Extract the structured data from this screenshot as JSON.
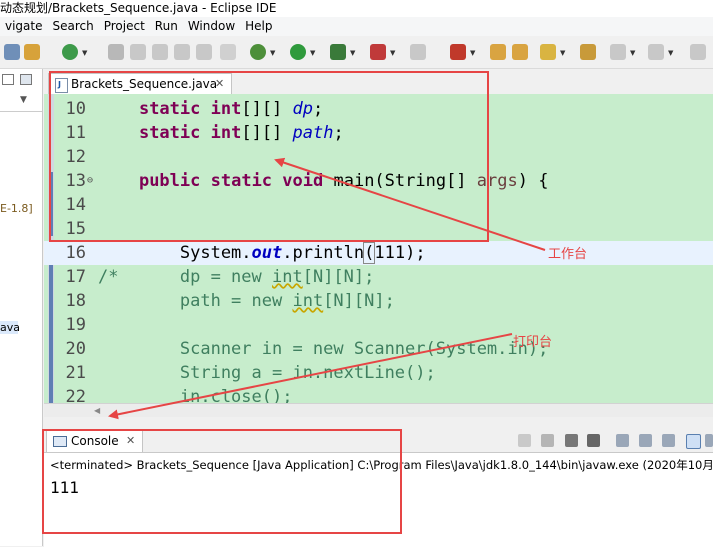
{
  "window": {
    "title": "动态规划/Brackets_Sequence.java - Eclipse IDE"
  },
  "menu": {
    "items": [
      "vigate",
      "Search",
      "Project",
      "Run",
      "Window",
      "Help"
    ]
  },
  "left_panel": {
    "label_1": "E-1.8]",
    "label_2": "ava"
  },
  "editor": {
    "tab_label": "Brackets_Sequence.java",
    "close_glyph": "✕",
    "file_icon_letter": "J",
    "lines": [
      {
        "num": "10",
        "seg": [
          "    ",
          "static",
          " ",
          "int",
          "[][] ",
          "dp",
          ";"
        ]
      },
      {
        "num": "11",
        "seg": [
          "    ",
          "static",
          " ",
          "int",
          "[][] ",
          "path",
          ";"
        ]
      },
      {
        "num": "12"
      },
      {
        "num": "13",
        "fold": "⊖",
        "seg": [
          "    ",
          "public",
          " ",
          "static",
          " ",
          "void",
          " main(String[] ",
          "args",
          ") {"
        ]
      },
      {
        "num": "14"
      },
      {
        "num": "15"
      },
      {
        "num": "16",
        "seg": [
          "        System.",
          "out",
          ".println",
          "(",
          "111);"
        ]
      },
      {
        "num": "17",
        "seg": [
          "/*      dp = new ",
          "int",
          "[N][N];"
        ]
      },
      {
        "num": "18",
        "seg": [
          "        path = new ",
          "int",
          "[N][N];"
        ]
      },
      {
        "num": "19"
      },
      {
        "num": "20",
        "seg": [
          "        Scanner in = new Scanner(System.in);"
        ]
      },
      {
        "num": "21",
        "seg": [
          "        String a = in.nextLine();"
        ]
      },
      {
        "num": "22",
        "seg": [
          "        in.close();"
        ]
      }
    ]
  },
  "console": {
    "tab_label": "Console",
    "close_glyph": "✕",
    "status": "<terminated> Brackets_Sequence [Java Application] C:\\Program Files\\Java\\jdk1.8.0_144\\bin\\javaw.exe (2020年10月",
    "output": "111"
  },
  "annotations": {
    "workbench": "工作台",
    "console": "打印台"
  },
  "colors": {
    "annotation_red": "#e64545",
    "editor_bg": "#c7edcc",
    "keyword": "#7f0055",
    "field": "#0000c0"
  }
}
